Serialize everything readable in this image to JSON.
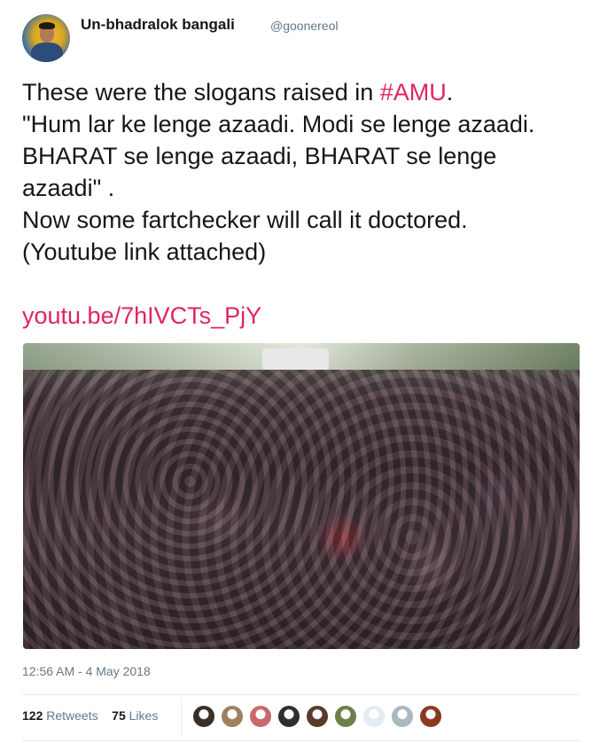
{
  "tweet": {
    "author": {
      "display_name": "Un-bhadralok bangali",
      "handle": "@goonereol"
    },
    "text_before_hashtag": "These were the slogans raised in ",
    "hashtag": "#AMU",
    "text_after_hashtag": ".\n\"Hum lar ke lenge azaadi. Modi se lenge azaadi. BHARAT se lenge azaadi, BHARAT se lenge azaadi\" .\nNow some fartchecker will call it doctored.\n(Youtube link attached)",
    "link": "youtu.be/7hIVCTs_PjY",
    "timestamp": "12:56 AM - 4 May 2018",
    "retweets_count": "122",
    "retweets_label": "Retweets",
    "likes_count": "75",
    "likes_label": "Likes"
  },
  "colors": {
    "accent": "#e0245e",
    "muted": "#657786",
    "text": "#14171a"
  },
  "likers": [
    {
      "name": "liker-avatar-1",
      "color": "#3b2e25"
    },
    {
      "name": "liker-avatar-2",
      "color": "#a08060"
    },
    {
      "name": "liker-avatar-3",
      "color": "#c86a6a"
    },
    {
      "name": "liker-avatar-4",
      "color": "#2e2e2e"
    },
    {
      "name": "liker-avatar-5",
      "color": "#5a3a2a"
    },
    {
      "name": "liker-avatar-6",
      "color": "#6f7f4a"
    },
    {
      "name": "liker-avatar-7",
      "color": "#e4ecf2"
    },
    {
      "name": "liker-avatar-8",
      "color": "#aab8c2"
    },
    {
      "name": "liker-avatar-9",
      "color": "#8a3a20"
    }
  ]
}
